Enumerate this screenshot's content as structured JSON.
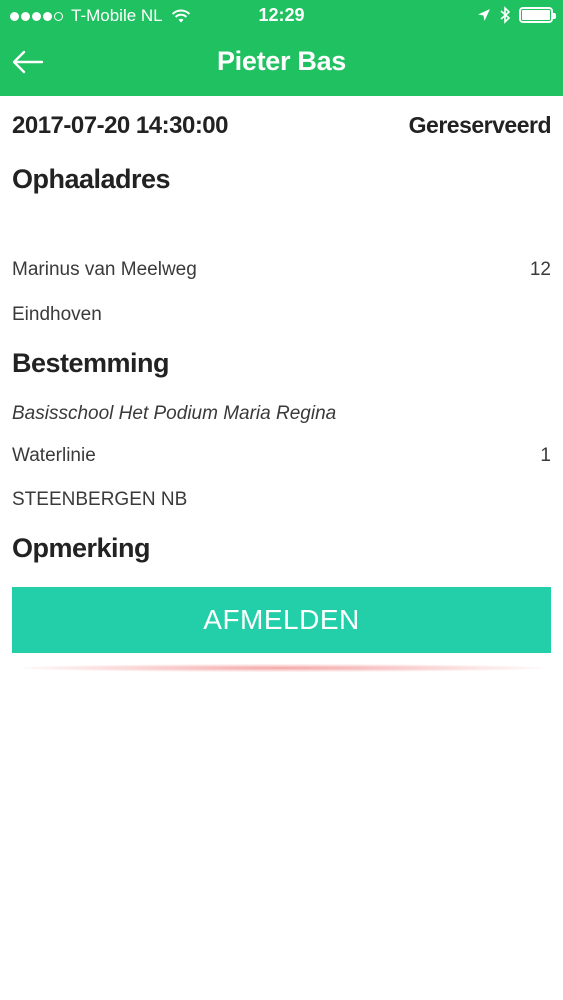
{
  "status_bar": {
    "carrier": "T-Mobile NL",
    "time": "12:29",
    "wifi_icon": "wifi-icon",
    "location_icon": "location-arrow-icon",
    "bluetooth_icon": "bluetooth-icon",
    "battery_icon": "battery-icon",
    "signal_bars": 4
  },
  "header": {
    "title": "Pieter Bas",
    "back_icon": "back-arrow-icon",
    "color": "#1fc160"
  },
  "ride": {
    "datetime": "2017-07-20 14:30:00",
    "status": "Gereserveerd"
  },
  "pickup": {
    "heading": "Ophaaladres",
    "street": "Marinus van Meelweg",
    "number": "12",
    "city": "Eindhoven"
  },
  "destination": {
    "heading": "Bestemming",
    "name": "Basisschool Het Podium Maria Regina",
    "street": "Waterlinie",
    "number": "1",
    "city": "STEENBERGEN NB"
  },
  "remark": {
    "heading": "Opmerking"
  },
  "actions": {
    "cancel_label": "AFMELDEN",
    "color": "#22cfa8"
  }
}
